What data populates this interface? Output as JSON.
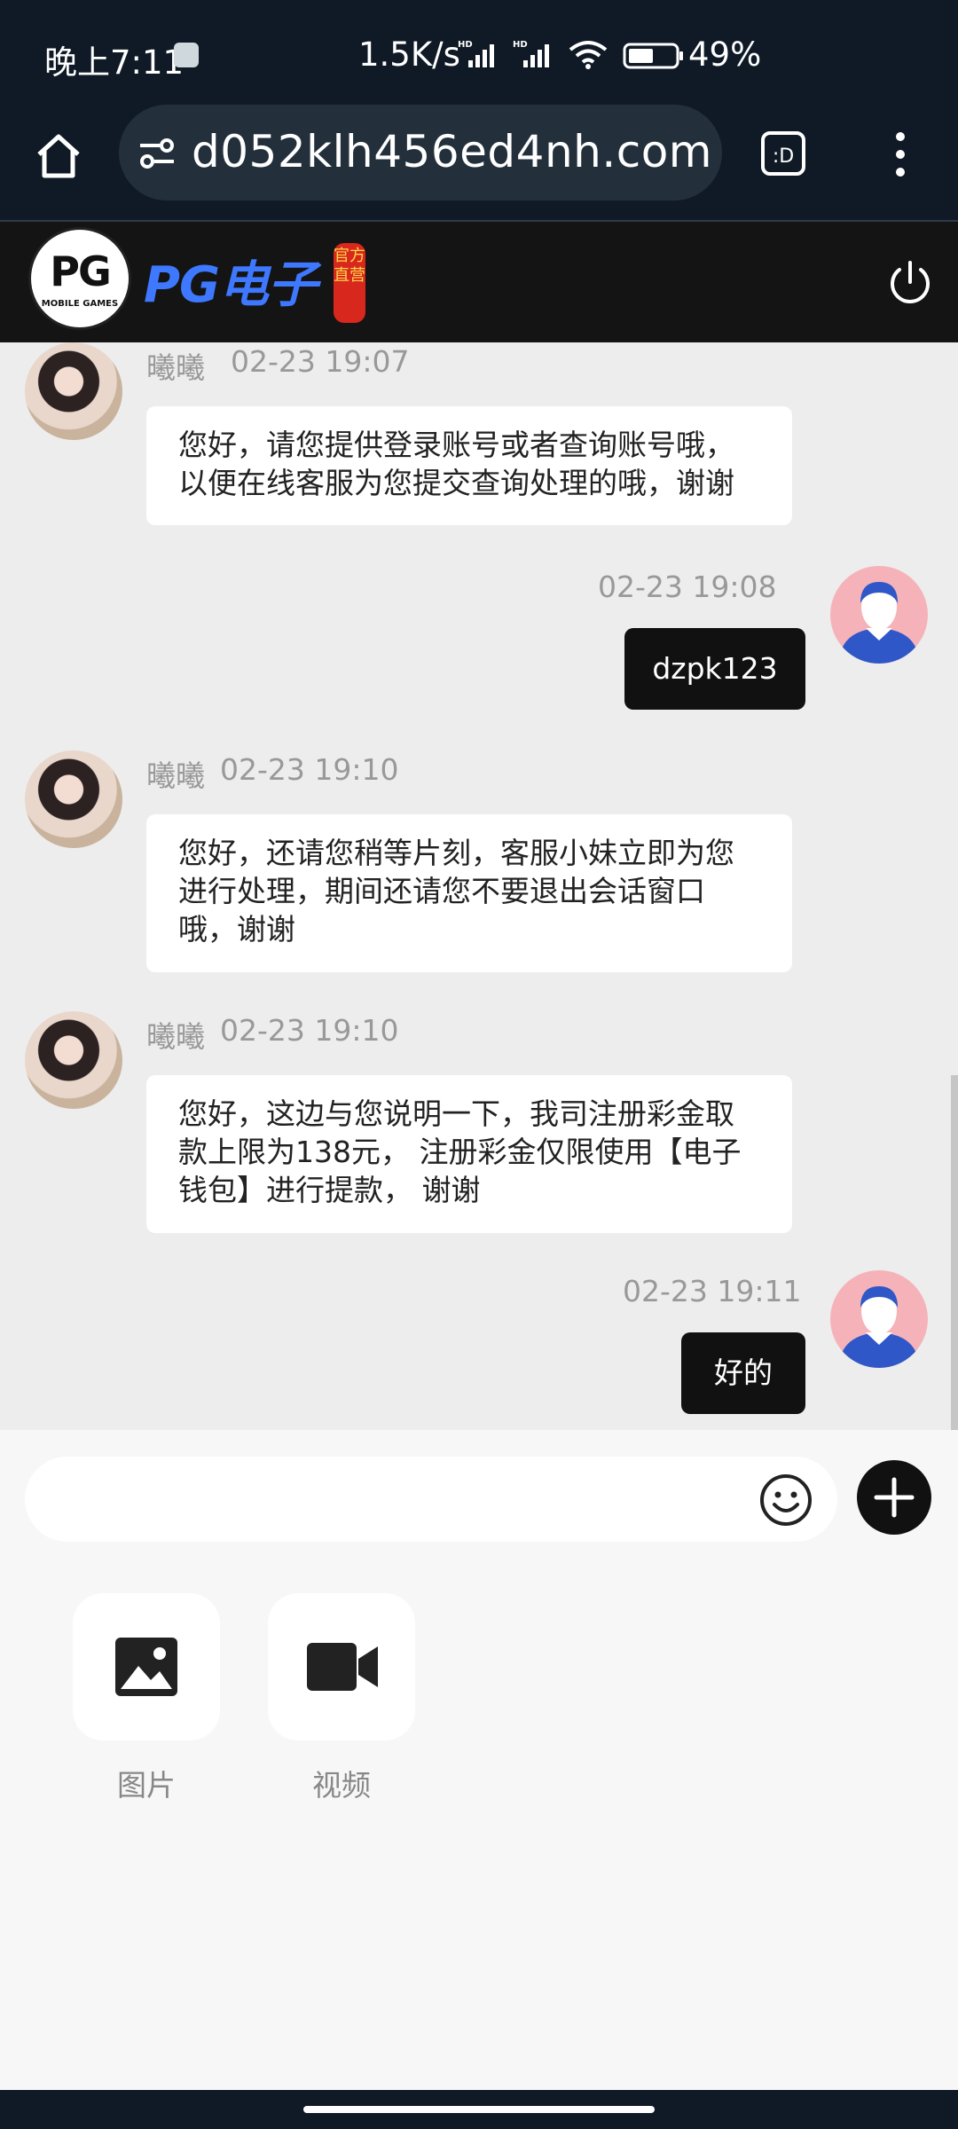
{
  "status_bar": {
    "time": "晚上7:11",
    "net_speed": "1.5K/s",
    "battery": "49%"
  },
  "browser": {
    "url": "d052klh456ed4nh.com",
    "tabs_label": ":D"
  },
  "header": {
    "logo_text": "PG",
    "logo_sub": "MOBILE GAMES",
    "brand": "PG电子",
    "seal_text": "官方直营"
  },
  "chat": {
    "messages": [
      {
        "name": "曦曦",
        "time": "02-23 19:07",
        "text": "您好，请您提供登录账号或者查询账号哦，以便在线客服为您提交查询处理的哦，谢谢"
      },
      {
        "time": "02-23 19:08",
        "text": "dzpk123"
      },
      {
        "name": "曦曦",
        "time": "02-23 19:10",
        "text": "您好，还请您稍等片刻，客服小妹立即为您进行处理，期间还请您不要退出会话窗口哦，谢谢"
      },
      {
        "name": "曦曦",
        "time": "02-23 19:10",
        "text": "您好，这边与您说明一下，我司注册彩金取款上限为138元， 注册彩金仅限使用【电子钱包】进行提款， 谢谢"
      },
      {
        "time": "02-23 19:11",
        "text": "好的"
      }
    ]
  },
  "composer": {
    "placeholder": "",
    "tiles": [
      {
        "label": "图片",
        "icon": "image-icon"
      },
      {
        "label": "视频",
        "icon": "video-icon"
      }
    ]
  },
  "colors": {
    "header_bg": "#141414",
    "brand_blue": "#3e78ff",
    "chat_bg": "#ededed",
    "user_bubble": "#111111"
  }
}
